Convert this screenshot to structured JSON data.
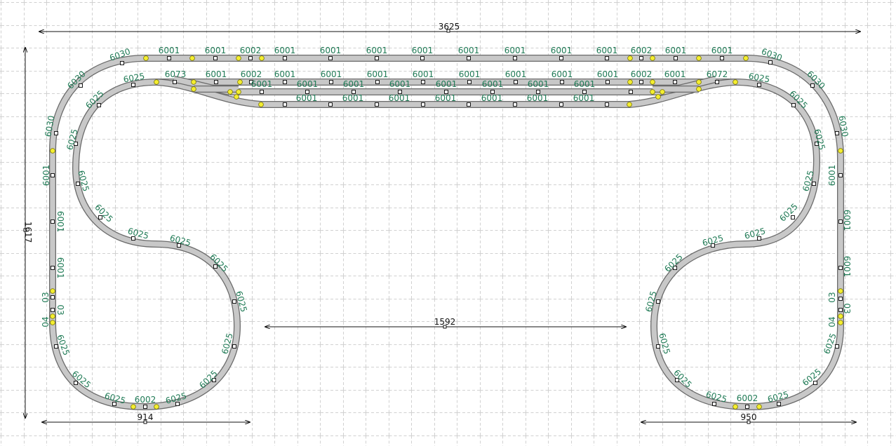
{
  "diagram": {
    "type": "model railway track plan",
    "grid": true,
    "dimensions": {
      "overall_width": "3625",
      "overall_height": "1617",
      "inner_gap": "1592",
      "left_loop_width": "914",
      "right_loop_width": "950"
    },
    "labels": {
      "t6030": "6030",
      "t6001": "6001",
      "t6002": "6002",
      "t6025": "6025",
      "t6073": "6073",
      "t6072": "6072",
      "t03": "03",
      "t04": "04"
    }
  }
}
